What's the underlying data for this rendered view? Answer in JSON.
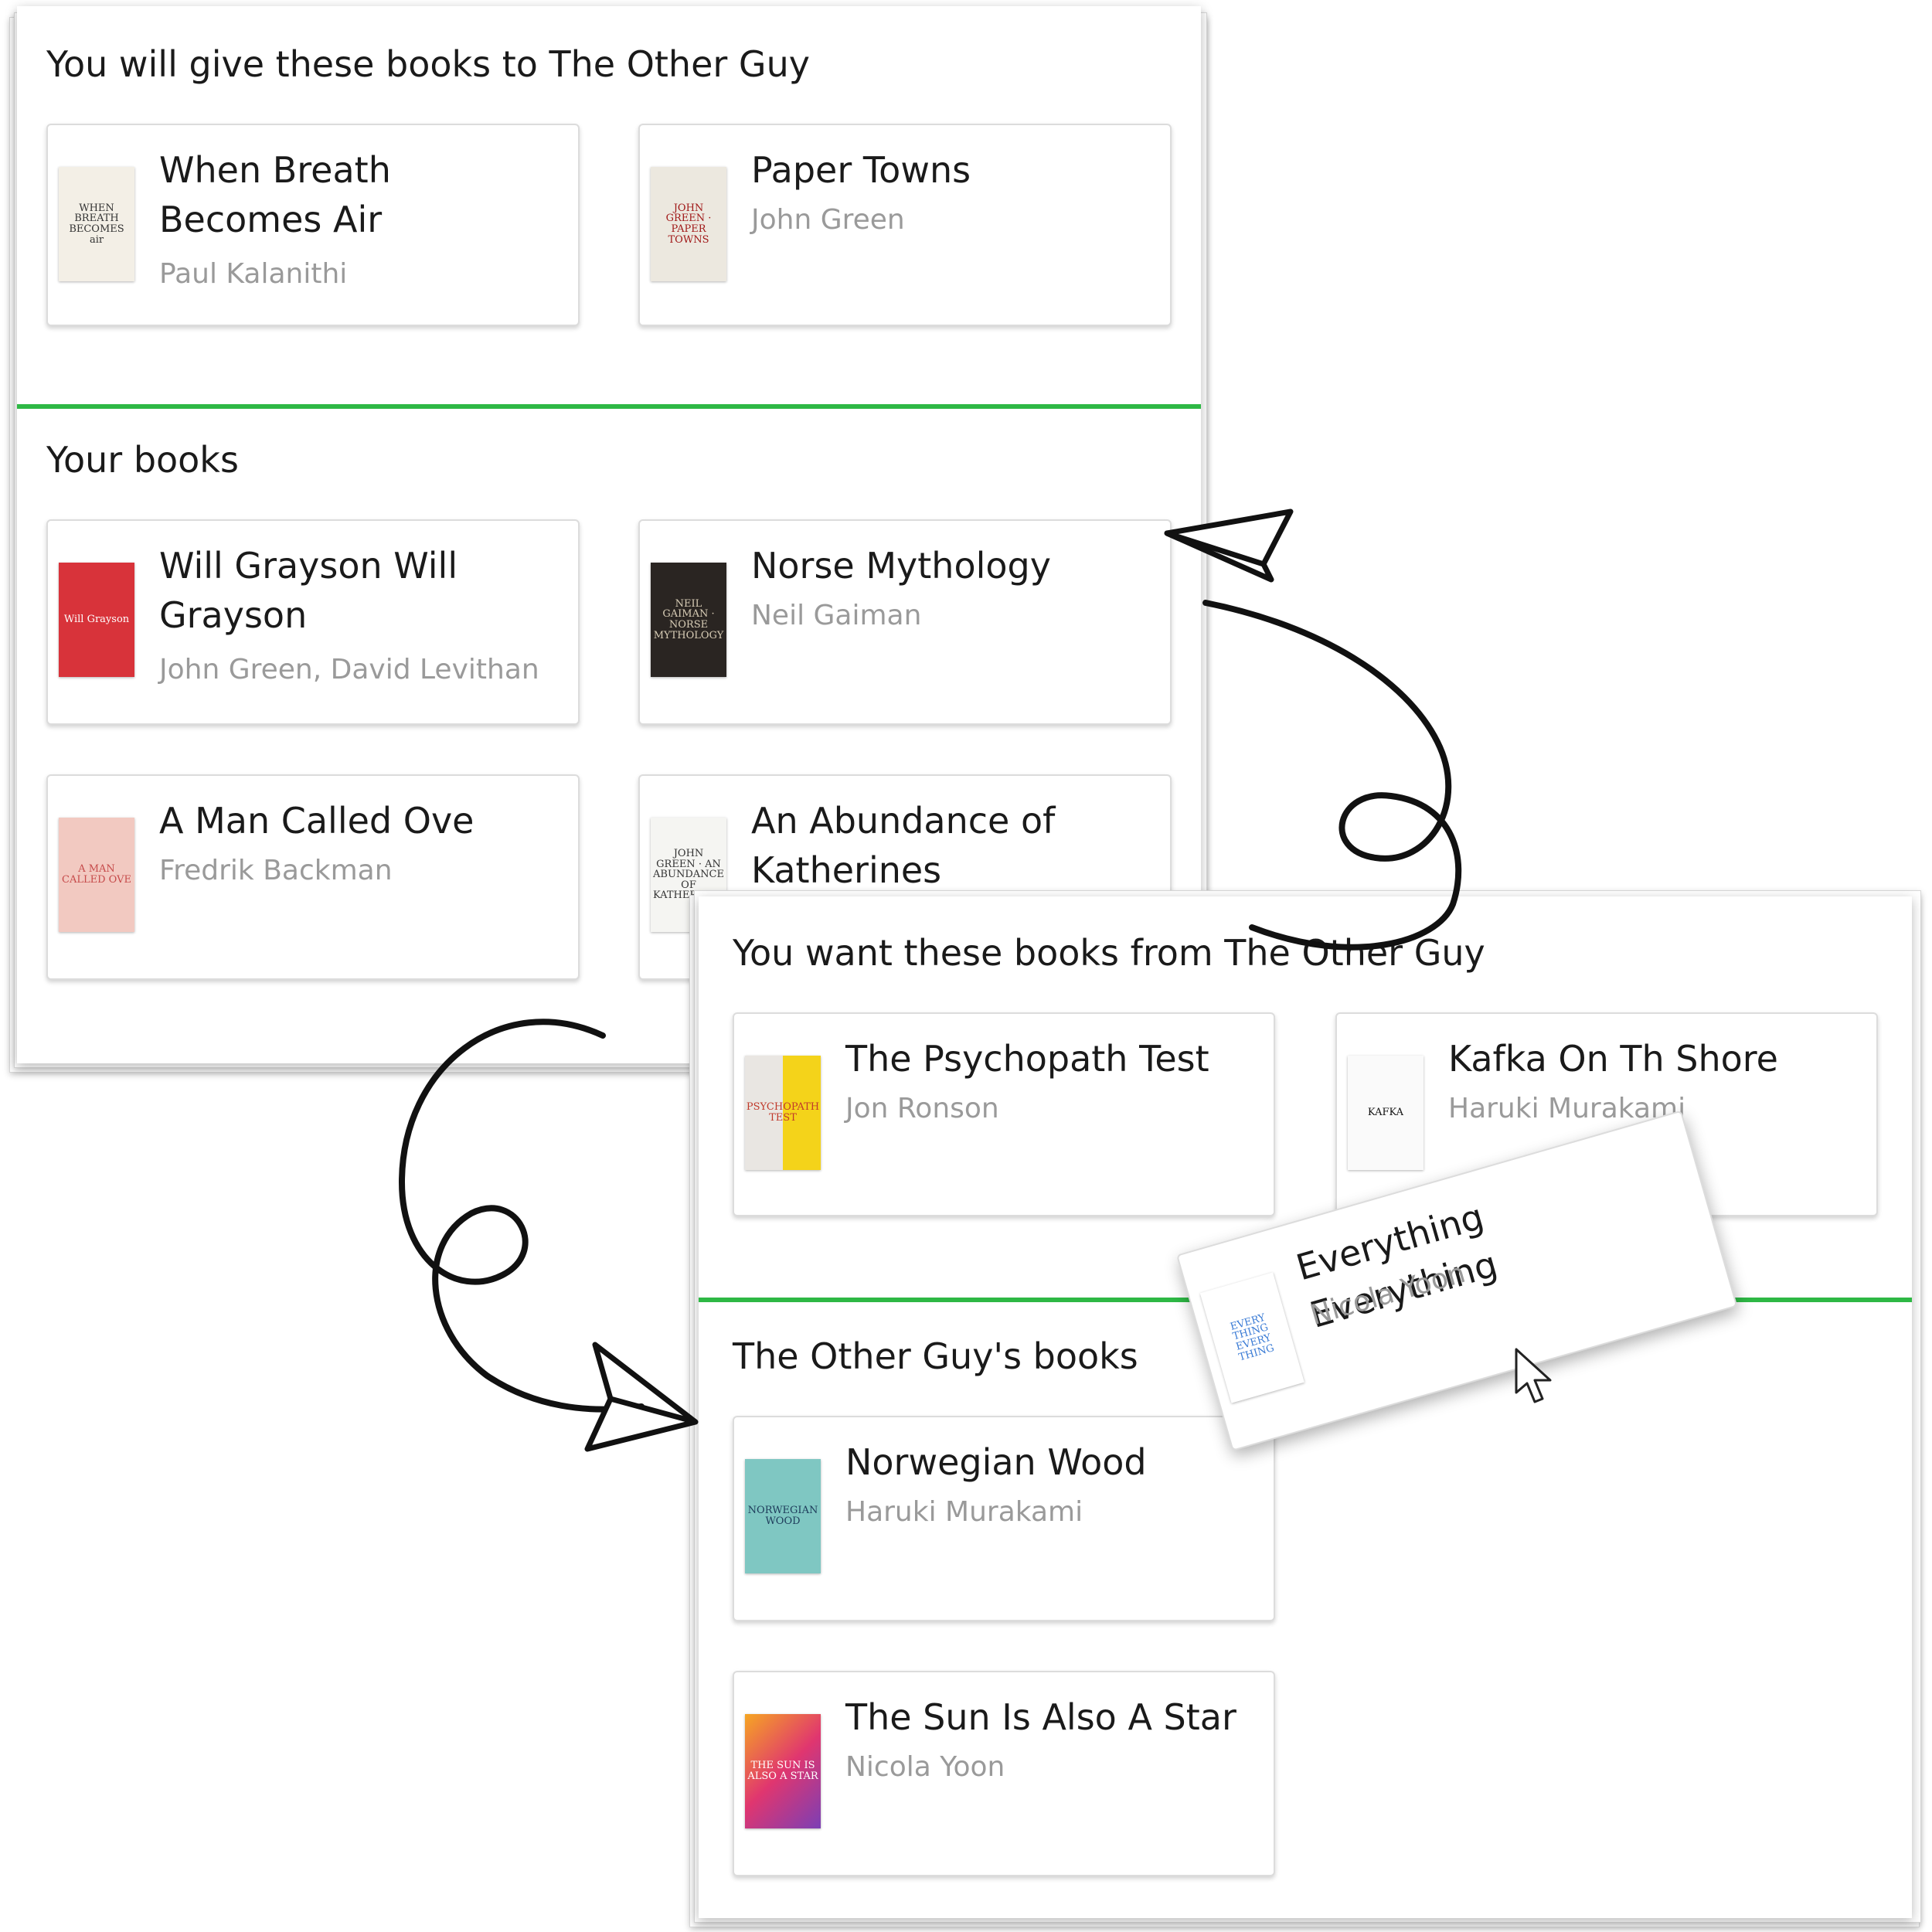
{
  "my_panel": {
    "give_title": "You will give these books to The Other Guy",
    "give_books": [
      {
        "title": "When Breath Becomes Air",
        "author": "Paul Kalanithi",
        "cover_text": "WHEN BREATH BECOMES air"
      },
      {
        "title": "Paper Towns",
        "author": "John Green",
        "cover_text": "JOHN GREEN · PAPER TOWNS"
      }
    ],
    "your_books_title": "Your books",
    "your_books": [
      {
        "title": "Will Grayson Will Grayson",
        "author": "John Green, David Levithan",
        "cover_text": "Will Grayson"
      },
      {
        "title": "Norse Mythology",
        "author": "Neil Gaiman",
        "cover_text": "NEIL GAIMAN · NORSE MYTHOLOGY"
      },
      {
        "title": "A Man Called Ove",
        "author": "Fredrik Backman",
        "cover_text": "A MAN CALLED OVE"
      },
      {
        "title": "An Abundance of Katherines",
        "author": "",
        "cover_text": "JOHN GREEN · AN ABUNDANCE OF KATHERINES"
      }
    ]
  },
  "other_panel": {
    "want_title": "You want these books from The Other Guy",
    "want_books": [
      {
        "title": "The Psychopath Test",
        "author": "Jon Ronson",
        "cover_text": "PSYCHOPATH TEST"
      },
      {
        "title": "Kafka On Th Shore",
        "author": "Haruki Murakami",
        "cover_text": "KAFKA"
      }
    ],
    "other_books_title": "The Other Guy's books",
    "other_books": [
      {
        "title": "Norwegian Wood",
        "author": "Haruki Murakami",
        "cover_text": "NORWEGIAN WOOD"
      },
      {
        "title": "The Sun Is Also A Star",
        "author": "Nicola Yoon",
        "cover_text": "THE SUN IS ALSO A STAR"
      }
    ]
  },
  "dragged_card": {
    "title": "Everything Everything",
    "author": "Nicola Yoon",
    "cover_text": "EVERY THING EVERY THING"
  },
  "colors": {
    "divider": "#2eb845",
    "author": "#9a9a9a",
    "title": "#1a1a1a"
  },
  "icons": [
    "curved-arrow-icon",
    "curved-arrow-icon",
    "mouse-cursor-icon"
  ]
}
